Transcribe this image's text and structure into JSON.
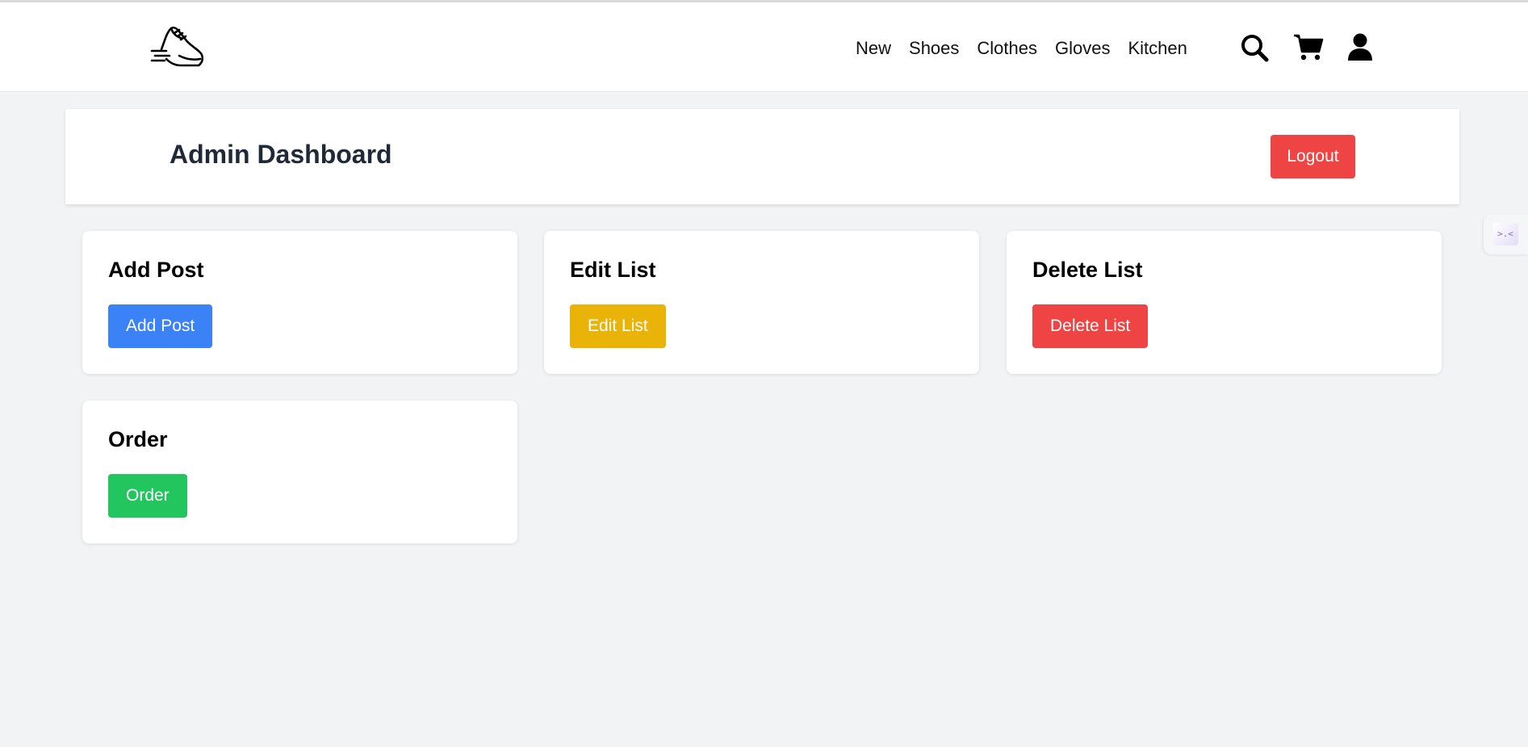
{
  "navbar": {
    "logo": "running-shoe-logo",
    "links": [
      "New",
      "Shoes",
      "Clothes",
      "Gloves",
      "Kitchen"
    ],
    "icons": [
      "search-icon",
      "cart-icon",
      "user-icon"
    ]
  },
  "header": {
    "title": "Admin Dashboard",
    "logout_label": "Logout"
  },
  "cards": [
    {
      "title": "Add Post",
      "button_label": "Add Post",
      "button_color": "#3b82f6"
    },
    {
      "title": "Edit List",
      "button_label": "Edit List",
      "button_color": "#eab308"
    },
    {
      "title": "Delete List",
      "button_label": "Delete List",
      "button_color": "#ef4444"
    },
    {
      "title": "Order",
      "button_label": "Order",
      "button_color": "#22c55e"
    }
  ],
  "side_widget": {
    "glyph": ">.<"
  },
  "colors": {
    "logout": "#ef4444",
    "page_bg": "#f2f3f5",
    "title_text": "#1f2937"
  }
}
